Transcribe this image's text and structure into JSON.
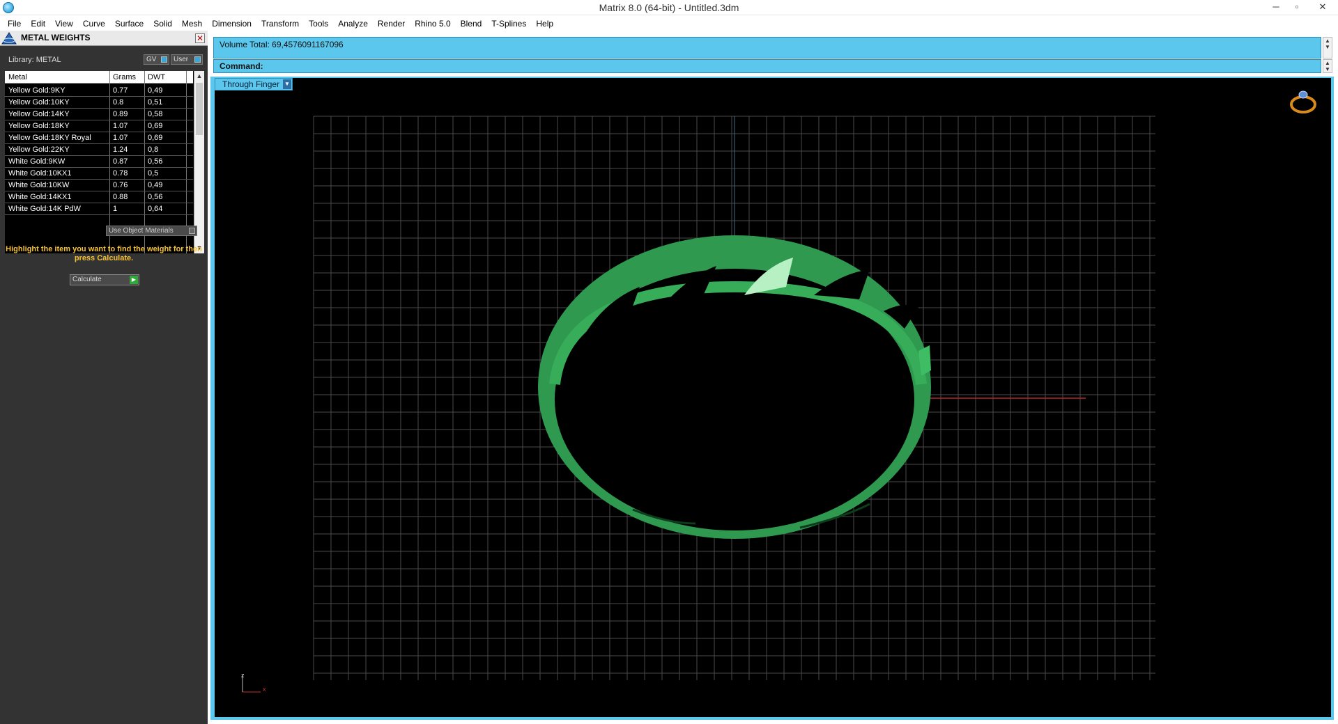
{
  "window": {
    "title": "Matrix 8.0 (64-bit) - Untitled.3dm",
    "minimize": "─",
    "maximize": "▫",
    "close": "✕"
  },
  "menu": [
    "File",
    "Edit",
    "View",
    "Curve",
    "Surface",
    "Solid",
    "Mesh",
    "Dimension",
    "Transform",
    "Tools",
    "Analyze",
    "Render",
    "Rhino 5.0",
    "Blend",
    "T-Splines",
    "Help"
  ],
  "panel": {
    "title": "METAL WEIGHTS",
    "close": "✕",
    "library_label": "Library: METAL",
    "toggle_gv": "GV",
    "toggle_user": "User",
    "table": {
      "headers": [
        "Metal",
        "Grams",
        "DWT"
      ],
      "rows": [
        [
          "Yellow Gold:9KY",
          "0.77",
          "0,49"
        ],
        [
          "Yellow Gold:10KY",
          "0.8",
          "0,51"
        ],
        [
          "Yellow Gold:14KY",
          "0.89",
          "0,58"
        ],
        [
          "Yellow Gold:18KY",
          "1.07",
          "0,69"
        ],
        [
          "Yellow Gold:18KY Royal",
          "1.07",
          "0,69"
        ],
        [
          "Yellow Gold:22KY",
          "1.24",
          "0,8"
        ],
        [
          "White Gold:9KW",
          "0.87",
          "0,56"
        ],
        [
          "White Gold:10KX1",
          "0.78",
          "0,5"
        ],
        [
          "White Gold:10KW",
          "0.76",
          "0,49"
        ],
        [
          "White Gold:14KX1",
          "0.88",
          "0,56"
        ],
        [
          "White Gold:14K PdW",
          "1",
          "0,64"
        ]
      ],
      "scroll_up": "▲",
      "scroll_down": "▼"
    },
    "use_object_materials": "Use Object Materials",
    "instruction": "Highlight the item you want to find the weight for then press Calculate.",
    "calculate": "Calculate",
    "calculate_go": "▶"
  },
  "command": {
    "history": "Volume Total: 69,4576091167096",
    "prompt": "Command:",
    "scroll_up": "▲",
    "scroll_down": "▼"
  },
  "viewport": {
    "view_name": "Through Finger",
    "dropdown_arrow": "▼",
    "axis_x": "x",
    "axis_z": "z",
    "model_color": "#2f9a4f",
    "grid_color": "#4a4a4a",
    "x_axis_color": "#b02a2a",
    "y_axis_color": "#3e6f80"
  }
}
